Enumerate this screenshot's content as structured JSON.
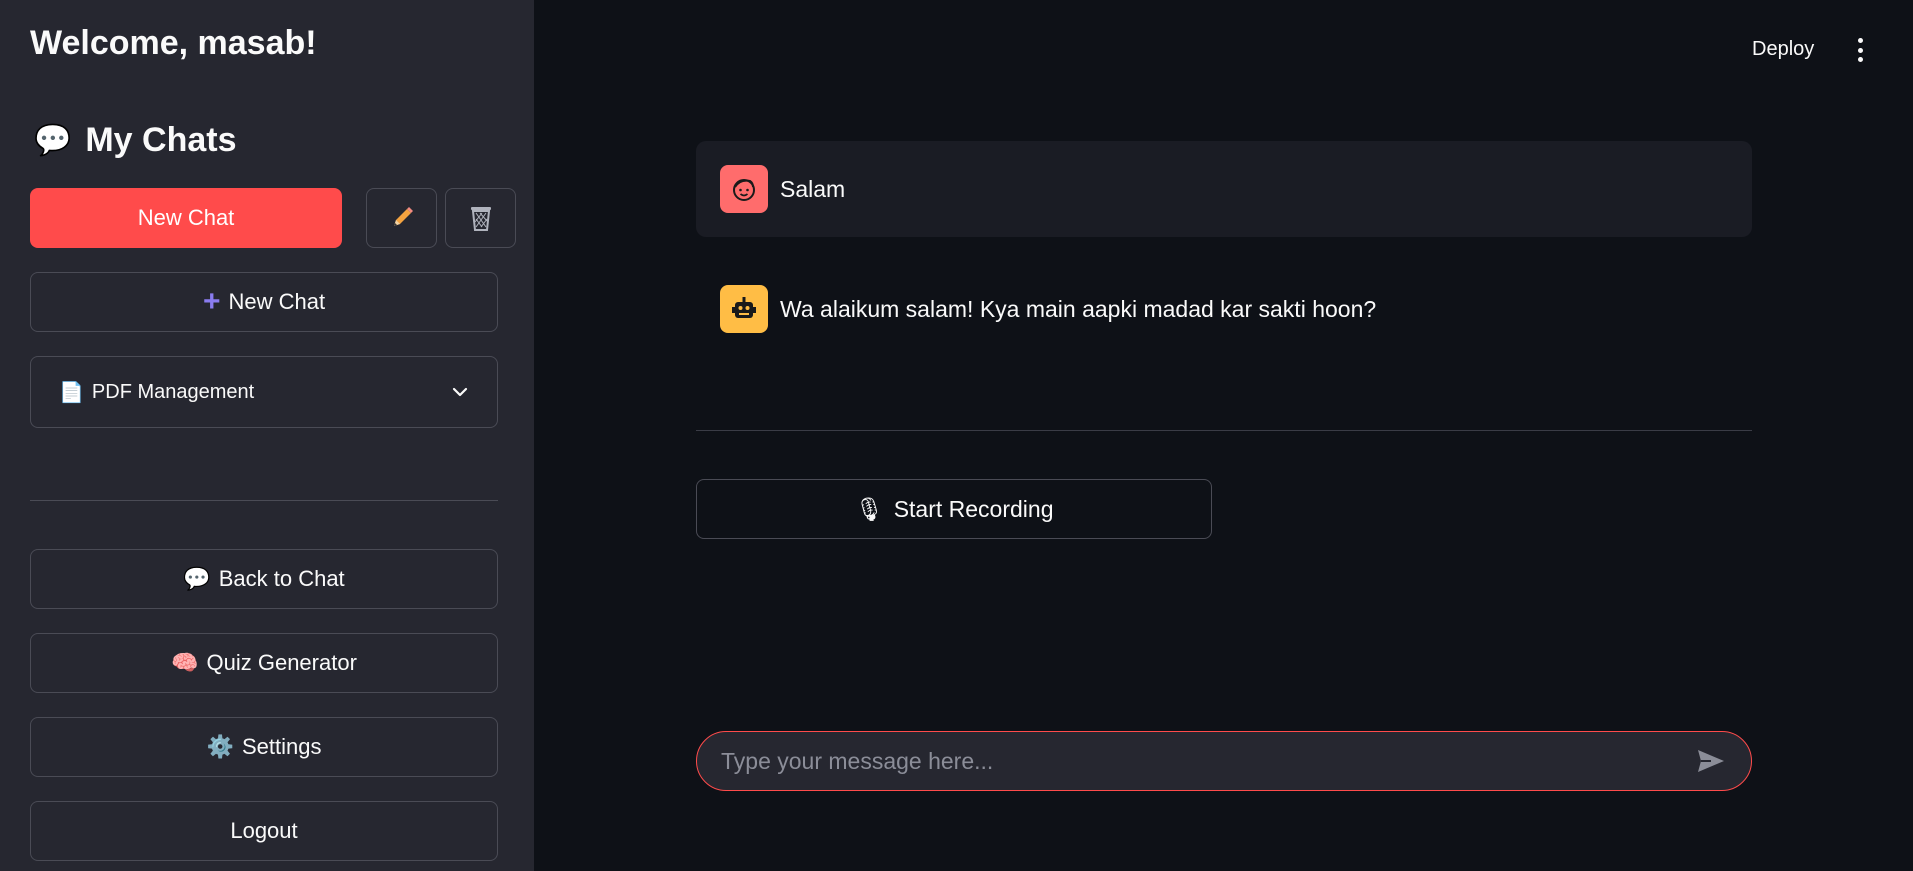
{
  "sidebar": {
    "welcome": "Welcome, masab!",
    "chats_heading": "My Chats",
    "new_chat_primary": "New Chat",
    "new_chat_secondary": "New Chat",
    "pdf_expander": "PDF Management",
    "nav": [
      {
        "icon": "💬",
        "label": "Back to Chat"
      },
      {
        "icon": "🧠",
        "label": "Quiz Generator"
      },
      {
        "icon": "⚙️",
        "label": "Settings"
      },
      {
        "icon": "",
        "label": "Logout"
      }
    ]
  },
  "header": {
    "deploy": "Deploy"
  },
  "messages": [
    {
      "role": "user",
      "text": "Salam"
    },
    {
      "role": "assistant",
      "text": "Wa alaikum salam! Kya main aapki madad kar sakti hoon?"
    }
  ],
  "recording": {
    "icon": "🎙",
    "label": "Start Recording"
  },
  "input": {
    "placeholder": "Type your message here...",
    "value": ""
  },
  "colors": {
    "primary": "#ff4b4b",
    "sidebar_bg": "#262730",
    "main_bg": "#0e1117",
    "user_avatar": "#ff6c6c",
    "bot_avatar": "#ffbd45"
  }
}
